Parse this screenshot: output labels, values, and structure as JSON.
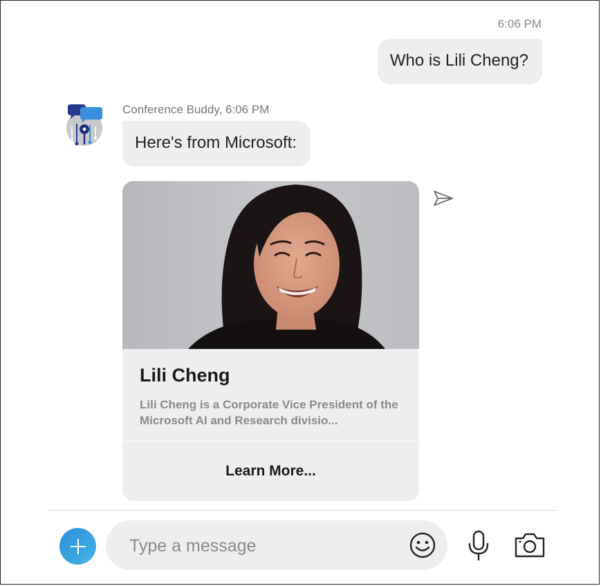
{
  "conversation": {
    "user_message": {
      "time": "6:06 PM",
      "text": "Who is Lili Cheng?"
    },
    "bot_message": {
      "sender_line": "Conference Buddy, 6:06 PM",
      "text": "Here's from Microsoft:"
    },
    "card": {
      "image_alt": "Portrait photo of Lili Cheng",
      "title": "Lili Cheng",
      "description": "Lili Cheng is a Corporate Vice President of the Microsoft AI and Research divisio...",
      "action_label": "Learn More..."
    }
  },
  "composer": {
    "placeholder": "Type a message",
    "value": ""
  },
  "icons": {
    "add": "plus-icon",
    "emoji": "smiley-icon",
    "mic": "microphone-icon",
    "camera": "camera-icon",
    "share": "send-arrow-icon",
    "avatar": "bot-avatar-icon"
  },
  "colors": {
    "bubble_bg": "#eeeef1",
    "accent_blue": "#3aa5e0",
    "muted_text": "#8a8a8a"
  }
}
